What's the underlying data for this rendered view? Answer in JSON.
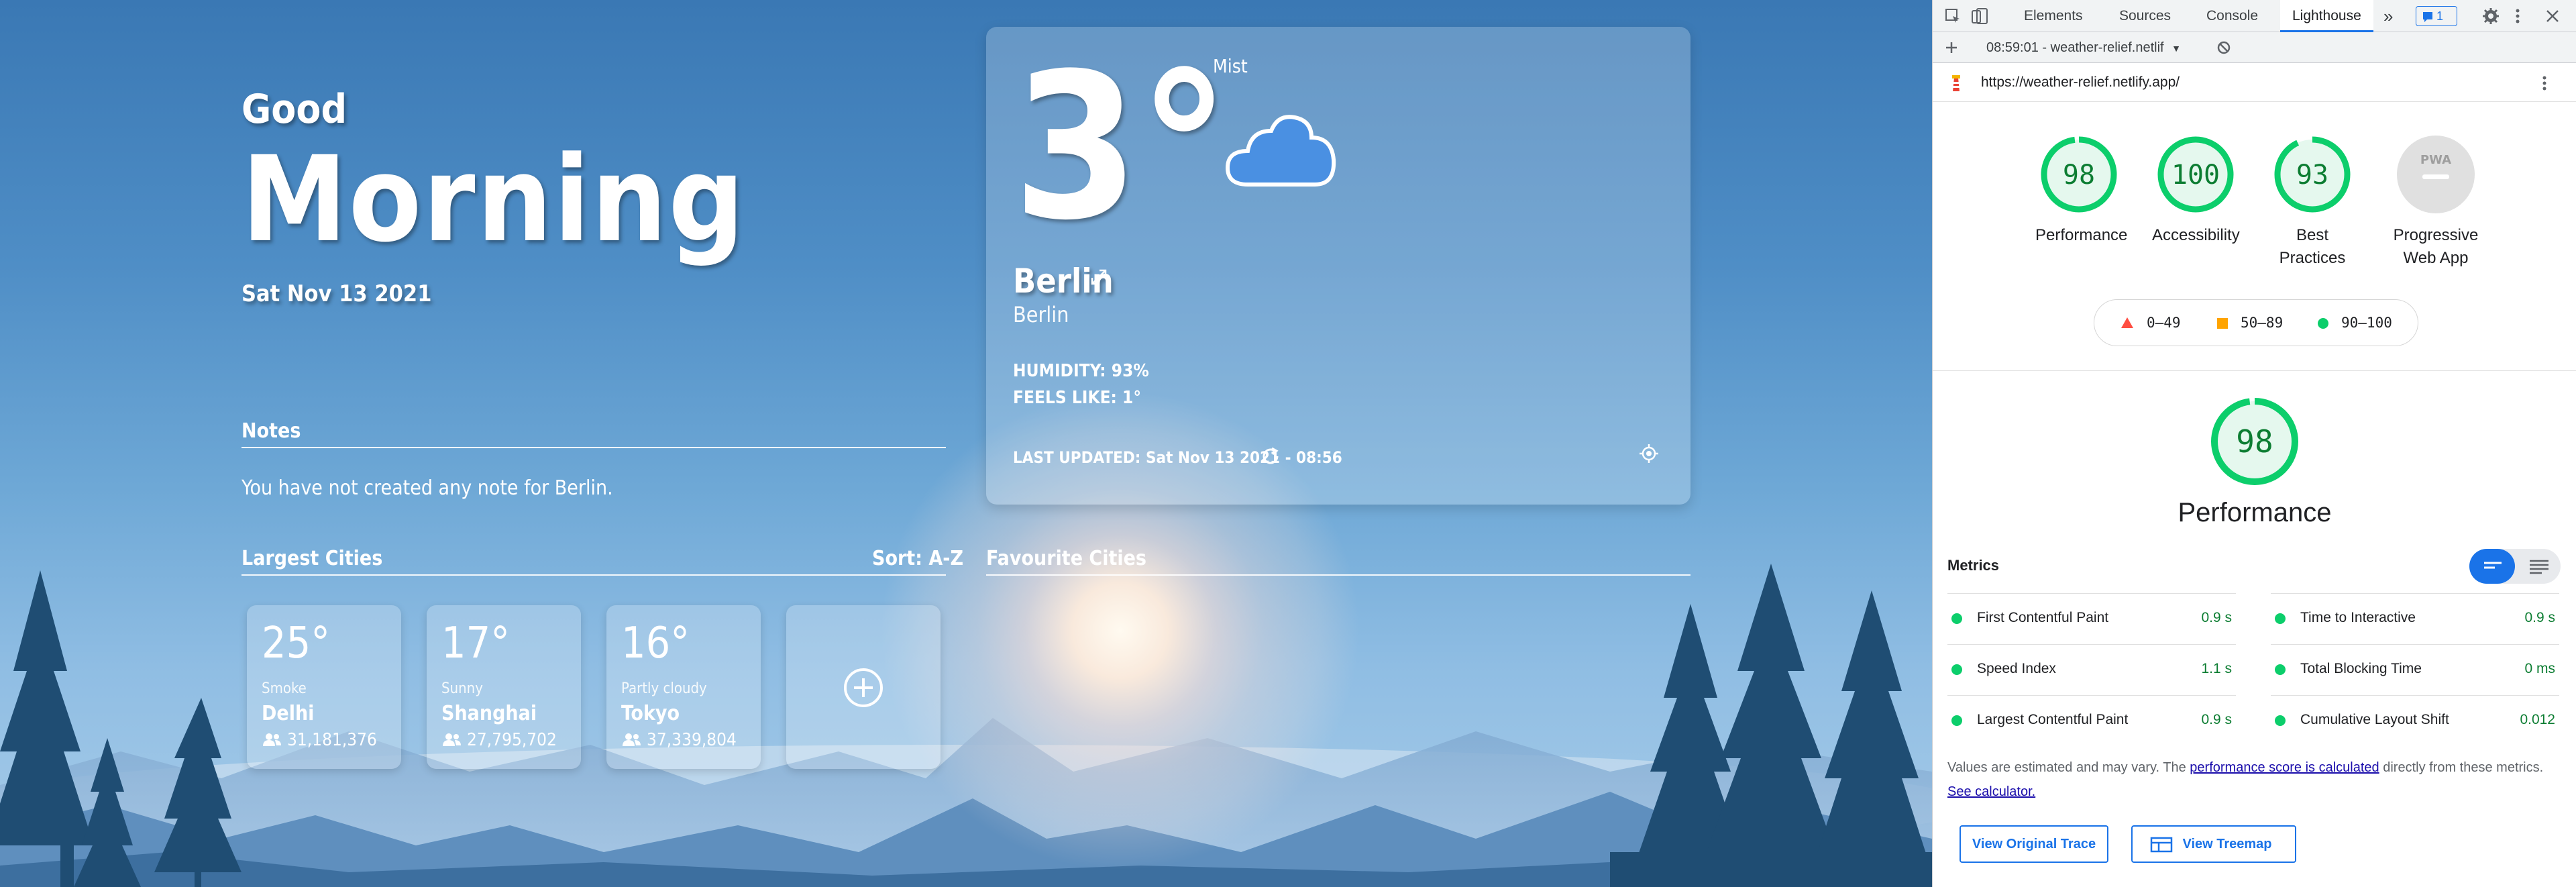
{
  "app": {
    "greeting_small": "Good",
    "greeting_big": "Morning",
    "date": "Sat Nov 13 2021",
    "weather": {
      "temp": "3°",
      "condition": "Mist",
      "city": "Berlin",
      "city_sub": "Berlin",
      "humidity": "HUMIDITY: 93%",
      "feels_like": "FEELS LIKE: 1°",
      "last_updated": "LAST UPDATED: Sat Nov 13 2021 - 08:56"
    },
    "notes": {
      "title": "Notes",
      "empty_text": "You have not created any note for Berlin."
    },
    "largest_cities": {
      "title": "Largest Cities",
      "sort_label": "Sort: A-Z",
      "cities": [
        {
          "temp": "25°",
          "condition": "Smoke",
          "name": "Delhi",
          "population": "31,181,376"
        },
        {
          "temp": "17°",
          "condition": "Sunny",
          "name": "Shanghai",
          "population": "27,795,702"
        },
        {
          "temp": "16°",
          "condition": "Partly cloudy",
          "name": "Tokyo",
          "population": "37,339,804"
        }
      ]
    },
    "favourites": {
      "title": "Favourite Cities"
    },
    "icons": [
      "cloud-icon",
      "expand-icon",
      "refresh-icon",
      "locate-icon",
      "people-icon",
      "add-icon"
    ]
  },
  "devtools": {
    "tabs": [
      "Elements",
      "Sources",
      "Console",
      "Lighthouse"
    ],
    "more_tabs": "»",
    "issues_count": "1",
    "report_select": "08:59:01 - weather-relief.netlif",
    "url": "https://weather-relief.netlify.app/",
    "scores": [
      {
        "label": "Performance",
        "score": 98
      },
      {
        "label": "Accessibility",
        "score": 100
      },
      {
        "label_line1": "Best",
        "label_line2": "Practices",
        "score": 93
      },
      {
        "label_line1": "Progressive",
        "label_line2": "Web App",
        "pwa_badge": "PWA"
      }
    ],
    "legend": {
      "fail": "0–49",
      "average": "50–89",
      "pass": "90–100"
    },
    "legend_colors": {
      "fail": "#ff4e42",
      "average": "#ffa400",
      "pass": "#0cce6b"
    },
    "performance": {
      "score": 98,
      "title": "Performance"
    },
    "metrics_label": "Metrics",
    "metrics": [
      {
        "name": "First Contentful Paint",
        "value": "0.9 s"
      },
      {
        "name": "Time to Interactive",
        "value": "0.9 s"
      },
      {
        "name": "Speed Index",
        "value": "1.1 s"
      },
      {
        "name": "Total Blocking Time",
        "value": "0 ms"
      },
      {
        "name": "Largest Contentful Paint",
        "value": "0.9 s"
      },
      {
        "name": "Cumulative Layout Shift",
        "value": "0.012"
      }
    ],
    "note_prefix": "Values are estimated and may vary. The ",
    "note_link1": "performance score is calculated",
    "note_middle": " directly from these metrics. ",
    "note_link2": "See calculator.",
    "btn_trace": "View Original Trace",
    "btn_treemap": "View Treemap"
  }
}
